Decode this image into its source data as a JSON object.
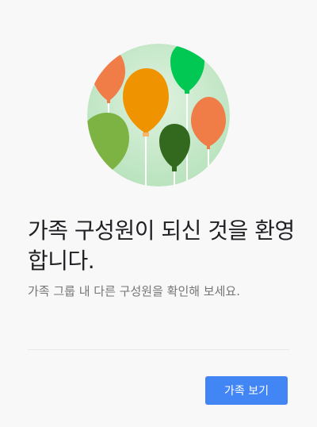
{
  "welcome": {
    "title": "가족 구성원이 되신 것을 환영합니다.",
    "subtitle": "가족 그룹 내 다른 구성원을 확인해 보세요.",
    "primary_button_label": "가족 보기",
    "illustration_icon": "balloons-illustration"
  },
  "colors": {
    "background": "#f8f8f8",
    "button": "#4285f4",
    "button_text": "#ffffff",
    "title_text": "#202124",
    "subtitle_text": "#757575"
  }
}
